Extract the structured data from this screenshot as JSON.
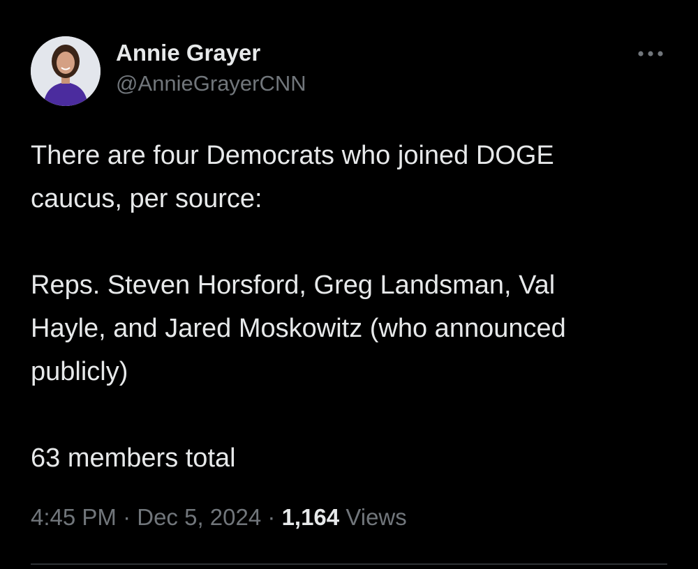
{
  "author": {
    "display_name": "Annie Grayer",
    "handle": "@AnnieGrayerCNN",
    "avatar_icon": "profile-photo"
  },
  "more_icon": "more-horizontal-icon",
  "tweet": {
    "lines": [
      "There are four Democrats who joined DOGE",
      "caucus, per source:",
      "",
      "Reps. Steven Horsford, Greg Landsman, Val",
      "Hayle, and Jared Moskowitz (who announced",
      "publicly)",
      "",
      "63 members total"
    ]
  },
  "meta": {
    "time": "4:45 PM",
    "separator": "·",
    "date": "Dec 5, 2024",
    "views_count": "1,164",
    "views_label": "Views"
  },
  "colors": {
    "background": "#000000",
    "primary_text": "#e7e9ea",
    "secondary_text": "#71767b",
    "divider": "#2f3336"
  }
}
